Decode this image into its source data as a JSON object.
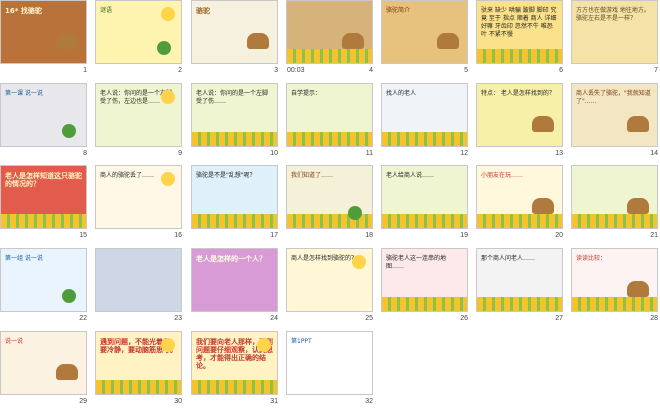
{
  "timer": "00:03",
  "slides": [
    {
      "num": "1",
      "bg": "#b9733a",
      "text": "16* 找骆驼",
      "color": "#fff7d0"
    },
    {
      "num": "2",
      "bg": "#fff3b0",
      "text": "谜语",
      "color": "#2d6e1f"
    },
    {
      "num": "3",
      "bg": "#f6f1df",
      "text": "骆驼",
      "color": "#9c6a2a"
    },
    {
      "num": "4",
      "bg": "#d7b37c",
      "text": "",
      "color": "#333"
    },
    {
      "num": "5",
      "bg": "#e7c27e",
      "text": "骆驼简介",
      "color": "#7a3a12"
    },
    {
      "num": "6",
      "bg": "#fbe28a",
      "text": "驮来 缺少 哄骗 跛脚 脚印 究竟 至于 指点 顺着 商人 详细 好嘛 牙齿印 忽然不牛 唯恐叶 不紧不慢",
      "color": "#1d1d1d"
    },
    {
      "num": "7",
      "bg": "#f4e2a6",
      "text": "方方也在做游戏 地往地方。 骆驼左右是不是一样？",
      "color": "#5a4a1a"
    },
    {
      "num": "8",
      "bg": "#e8e7ec",
      "text": "第一课 说一说",
      "color": "#1a5a9e"
    },
    {
      "num": "9",
      "bg": "#eef5d0",
      "text": "老人说：你问的是一个左脚受了伤，左边也是……",
      "color": "#1d1d1d"
    },
    {
      "num": "10",
      "bg": "#eef5d0",
      "text": "老人说：你问的是一个左脚受了伤……",
      "color": "#1d1d1d"
    },
    {
      "num": "11",
      "bg": "#eef5d0",
      "text": "自学提示：",
      "color": "#1d1d1d"
    },
    {
      "num": "12",
      "bg": "#f0f3f8",
      "text": "找人的老人",
      "color": "#1d1d1d"
    },
    {
      "num": "13",
      "bg": "#f7f0a8",
      "text": "特点： 老人是怎样找到的？",
      "color": "#1d1d1d"
    },
    {
      "num": "14",
      "bg": "#f3e6c3",
      "text": "商人丢失了骆驼，\"我就知道了\"……",
      "color": "#7a3a12"
    },
    {
      "num": "15",
      "bg": "#e25b4d",
      "text": "老人是怎样知道这只骆驼的情况的？",
      "color": "#fff4c2"
    },
    {
      "num": "16",
      "bg": "#fff8e6",
      "text": "商人的骆驼丢了……",
      "color": "#1d1d1d"
    },
    {
      "num": "17",
      "bg": "#dff0fb",
      "text": "骆驼是不是\"乱想\"呢？",
      "color": "#1d1d1d"
    },
    {
      "num": "18",
      "bg": "#f5f1d8",
      "text": "我们知道了……",
      "color": "#7a3a12"
    },
    {
      "num": "19",
      "bg": "#eef5d0",
      "text": "老人给商人说……",
      "color": "#1d1d1d"
    },
    {
      "num": "20",
      "bg": "#fff8dc",
      "text": "小朋友在玩……",
      "color": "#c0392b"
    },
    {
      "num": "21",
      "bg": "#eef5d0",
      "text": "",
      "color": "#1d1d1d"
    },
    {
      "num": "22",
      "bg": "#eaf4ff",
      "text": "第一组 说一说",
      "color": "#1a5a9e"
    },
    {
      "num": "23",
      "bg": "#cfd7e6",
      "text": "",
      "color": "#1d1d1d"
    },
    {
      "num": "24",
      "bg": "#d89bd6",
      "text": "老人是怎样的一个人？",
      "color": "#fffde6"
    },
    {
      "num": "25",
      "bg": "#fff7d6",
      "text": "商人是怎样找到骆驼的？",
      "color": "#1d1d1d"
    },
    {
      "num": "26",
      "bg": "#fde8ea",
      "text": "骆驼老人这一连串的地图……",
      "color": "#1d1d1d"
    },
    {
      "num": "27",
      "bg": "#f3f3f3",
      "text": "那个商人问老人……",
      "color": "#1d1d1d"
    },
    {
      "num": "28",
      "bg": "#fdf3f3",
      "text": "读读比较：",
      "color": "#c0392b"
    },
    {
      "num": "29",
      "bg": "#fbf2e2",
      "text": "说一说",
      "color": "#c0392b"
    },
    {
      "num": "30",
      "bg": "#fff3c4",
      "text": "遇到问题，不能光着急，要冷静，要动脑筋思考。",
      "color": "#c0392b"
    },
    {
      "num": "31",
      "bg": "#fff3c4",
      "text": "我们要向老人那样，遇到问题要仔细观察，认真思考，才能得出正确的结论。",
      "color": "#c0392b"
    },
    {
      "num": "32",
      "bg": "#ffffff",
      "text": "第1PPT",
      "color": "#1a5a9e"
    }
  ]
}
